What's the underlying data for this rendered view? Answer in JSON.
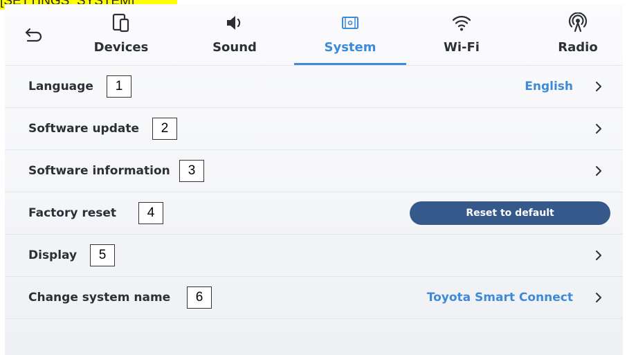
{
  "banner": {
    "text": "[SETTINGS_SYSTEM]"
  },
  "nav": {
    "back_icon": "back-arrow-icon",
    "tabs": [
      {
        "label": "Devices",
        "icon": "devices-icon",
        "active": false
      },
      {
        "label": "Sound",
        "icon": "speaker-icon",
        "active": false
      },
      {
        "label": "System",
        "icon": "system-icon",
        "active": true
      },
      {
        "label": "Wi-Fi",
        "icon": "wifi-icon",
        "active": false
      },
      {
        "label": "Radio",
        "icon": "radio-icon",
        "active": false
      }
    ]
  },
  "rows": [
    {
      "label": "Language",
      "marker": "1",
      "value": "English",
      "chevron": true
    },
    {
      "label": "Software update",
      "marker": "2",
      "chevron": true
    },
    {
      "label": "Software information",
      "marker": "3",
      "chevron": true
    },
    {
      "label": "Factory reset",
      "marker": "4",
      "button": "Reset to default"
    },
    {
      "label": "Display",
      "marker": "5",
      "chevron": true
    },
    {
      "label": "Change system name",
      "marker": "6",
      "value": "Toyota Smart Connect",
      "chevron": true
    }
  ],
  "colors": {
    "accent": "#3d8ad8",
    "button": "#35598a",
    "text": "#2c2f36",
    "banner": "#ffff00"
  }
}
